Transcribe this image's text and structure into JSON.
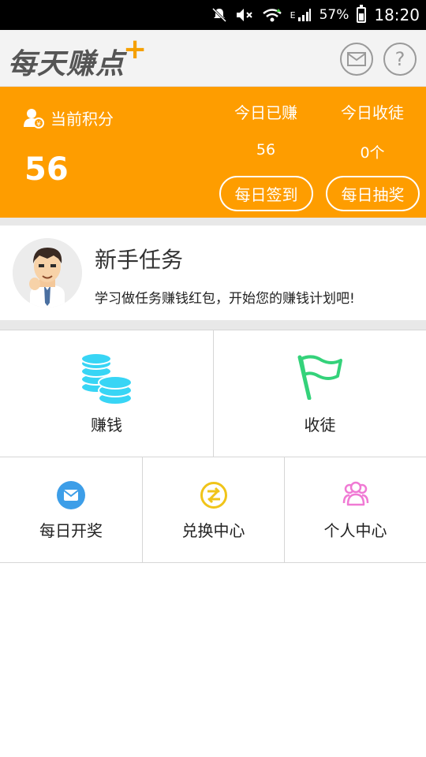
{
  "status_bar": {
    "battery_text": "57%",
    "time": "18:20",
    "network_label": "E",
    "battery_level": 0.57
  },
  "header": {
    "logo_text": "每天赚点",
    "logo_plus": "+",
    "icons": {
      "mail": "mail-icon",
      "help": "help-icon"
    },
    "help_glyph": "?"
  },
  "banner": {
    "points_label": "当前积分",
    "points_value": "56",
    "today_earned_label": "今日已赚",
    "today_earned_value": "56",
    "today_recruits_label": "今日收徒",
    "today_recruits_value": "0个",
    "checkin_label": "每日签到",
    "lottery_label": "每日抽奖",
    "accent_color": "#fe9d00"
  },
  "newbie_task": {
    "title": "新手任务",
    "description": "学习做任务赚钱红包，开始您的赚钱计划吧!"
  },
  "grid_main": [
    {
      "label": "赚钱",
      "icon": "coins-icon",
      "color": "#38d5f5"
    },
    {
      "label": "收徒",
      "icon": "flag-icon",
      "color": "#34d27a"
    }
  ],
  "grid_secondary": [
    {
      "label": "每日开奖",
      "icon": "mail-circle-icon",
      "color": "#3d9ee8"
    },
    {
      "label": "兑换中心",
      "icon": "exchange-icon",
      "color": "#f0c419"
    },
    {
      "label": "个人中心",
      "icon": "people-icon",
      "color": "#f07ad4"
    }
  ]
}
